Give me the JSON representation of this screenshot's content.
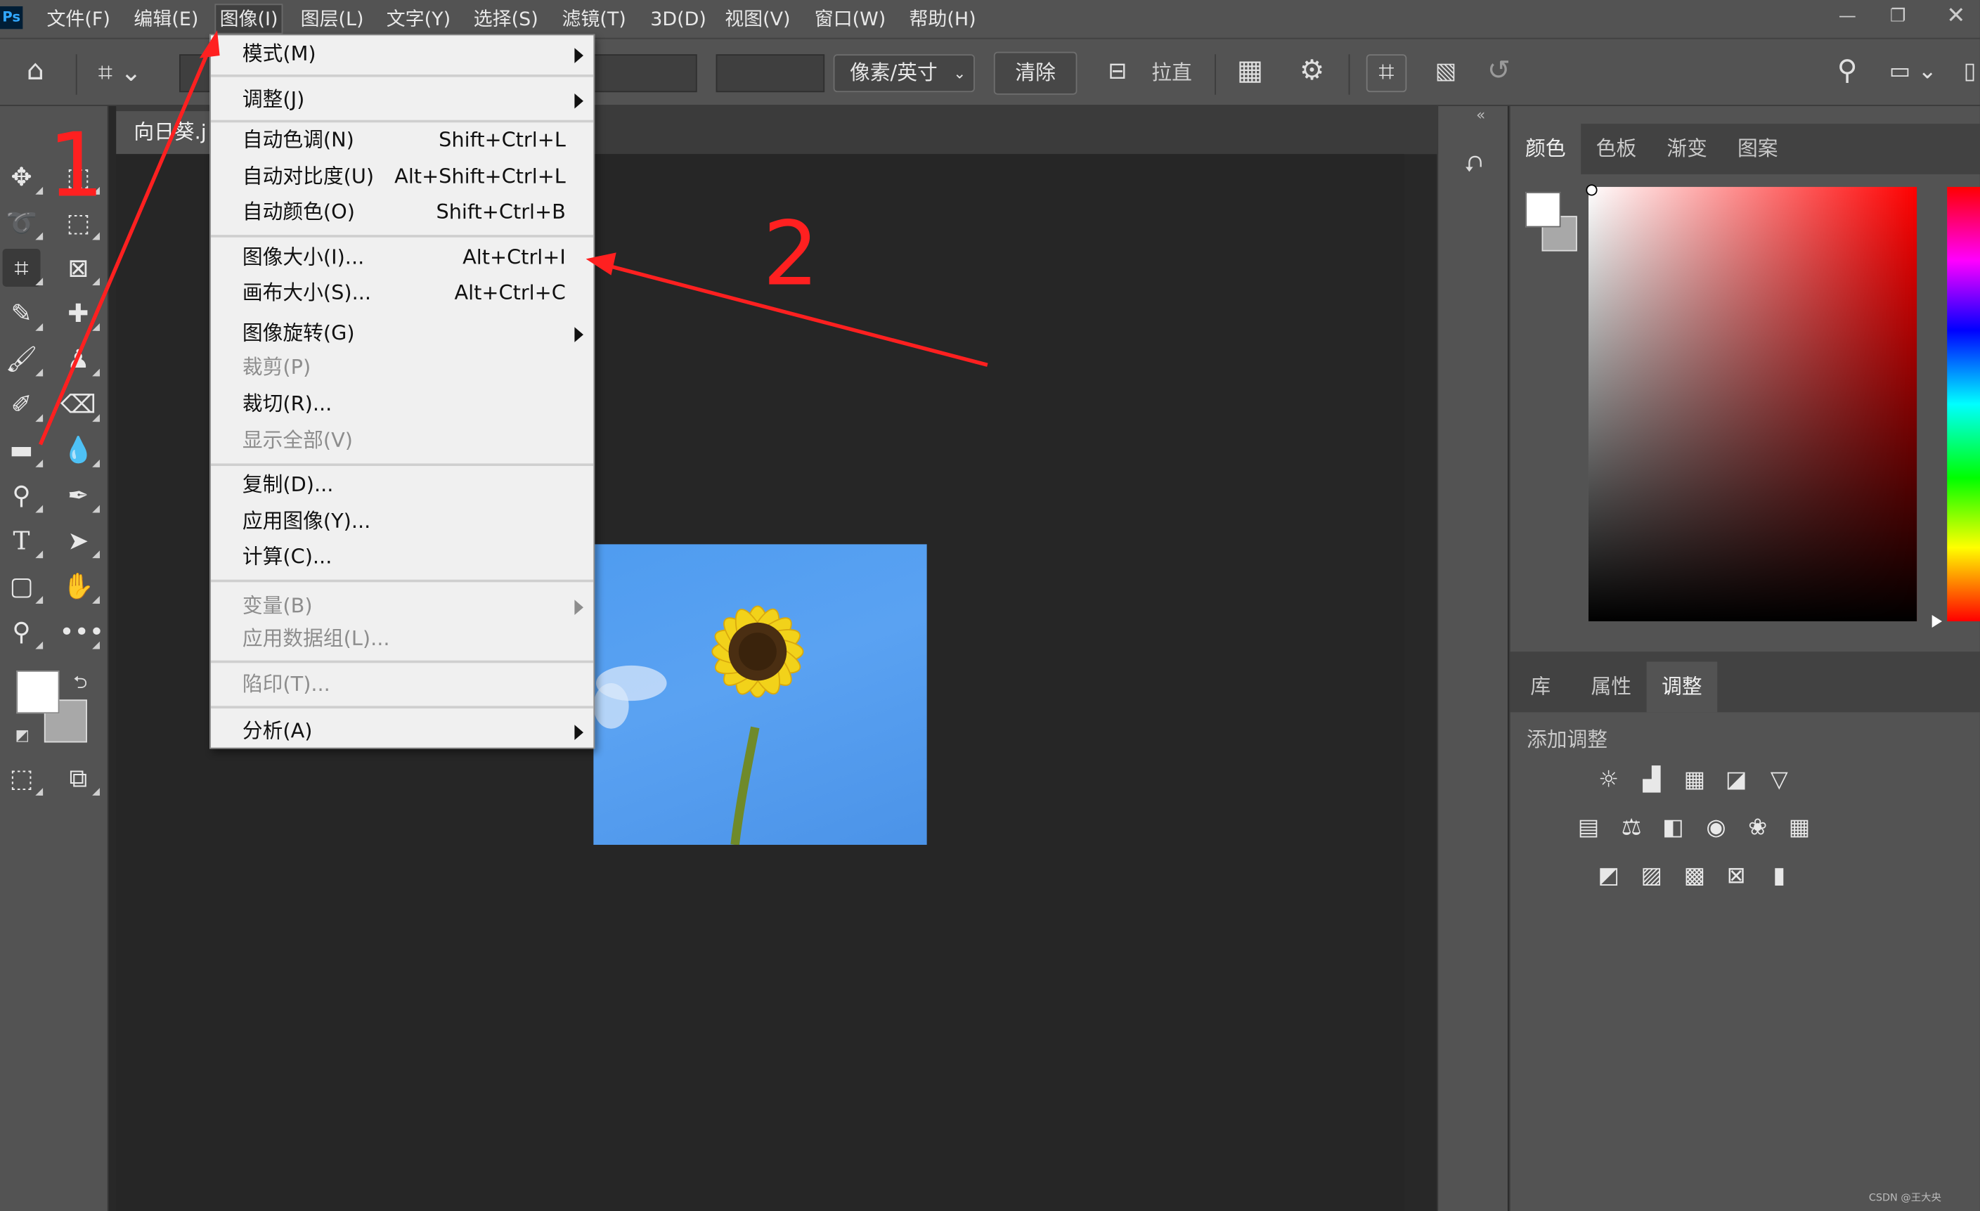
{
  "app": {
    "logo": "Ps"
  },
  "menubar": {
    "items": [
      "文件(F)",
      "编辑(E)",
      "图像(I)",
      "图层(L)",
      "文字(Y)",
      "选择(S)",
      "滤镜(T)",
      "3D(D)",
      "视图(V)",
      "窗口(W)",
      "帮助(H)"
    ],
    "active_item": "图像(I)"
  },
  "options_bar": {
    "unit_select": "像素/英寸",
    "clear_button": "清除",
    "straighten_label": "拉直"
  },
  "document": {
    "tab_title": "向日葵.j"
  },
  "image_menu": {
    "items": [
      {
        "label": "模式(M)",
        "shortcut": "",
        "submenu": true,
        "disabled": false
      },
      {
        "label": "调整(J)",
        "shortcut": "",
        "submenu": true,
        "disabled": false
      },
      {
        "label": "自动色调(N)",
        "shortcut": "Shift+Ctrl+L",
        "submenu": false,
        "disabled": false
      },
      {
        "label": "自动对比度(U)",
        "shortcut": "Alt+Shift+Ctrl+L",
        "submenu": false,
        "disabled": false
      },
      {
        "label": "自动颜色(O)",
        "shortcut": "Shift+Ctrl+B",
        "submenu": false,
        "disabled": false
      },
      {
        "label": "图像大小(I)...",
        "shortcut": "Alt+Ctrl+I",
        "submenu": false,
        "disabled": false
      },
      {
        "label": "画布大小(S)...",
        "shortcut": "Alt+Ctrl+C",
        "submenu": false,
        "disabled": false
      },
      {
        "label": "图像旋转(G)",
        "shortcut": "",
        "submenu": true,
        "disabled": false
      },
      {
        "label": "裁剪(P)",
        "shortcut": "",
        "submenu": false,
        "disabled": true
      },
      {
        "label": "裁切(R)...",
        "shortcut": "",
        "submenu": false,
        "disabled": false
      },
      {
        "label": "显示全部(V)",
        "shortcut": "",
        "submenu": false,
        "disabled": true
      },
      {
        "label": "复制(D)...",
        "shortcut": "",
        "submenu": false,
        "disabled": false
      },
      {
        "label": "应用图像(Y)...",
        "shortcut": "",
        "submenu": false,
        "disabled": false
      },
      {
        "label": "计算(C)...",
        "shortcut": "",
        "submenu": false,
        "disabled": false
      },
      {
        "label": "变量(B)",
        "shortcut": "",
        "submenu": true,
        "disabled": true
      },
      {
        "label": "应用数据组(L)...",
        "shortcut": "",
        "submenu": false,
        "disabled": true
      },
      {
        "label": "陷印(T)...",
        "shortcut": "",
        "submenu": false,
        "disabled": true
      },
      {
        "label": "分析(A)",
        "shortcut": "",
        "submenu": true,
        "disabled": false
      }
    ]
  },
  "color_panel": {
    "tabs": [
      "颜色",
      "色板",
      "渐变",
      "图案"
    ],
    "active_tab": "颜色"
  },
  "adjust_panel": {
    "tabs": [
      "库",
      "属性",
      "调整"
    ],
    "active_tab": "调整",
    "heading": "添加调整"
  },
  "annotations": {
    "step1": "1",
    "step2": "2"
  },
  "watermark": "CSDN @王大央",
  "colors": {
    "annotation_red": "#ff2020",
    "app_chrome": "#535353",
    "canvas_bg": "#282828",
    "menu_bg": "#f0f0f0"
  }
}
